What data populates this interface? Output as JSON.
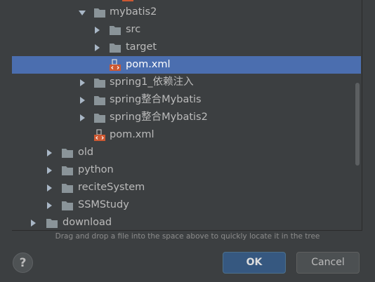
{
  "tree": {
    "items": [
      {
        "label": "mybatis2",
        "type": "folder",
        "expanded": true
      },
      {
        "label": "src",
        "type": "folder",
        "expanded": false
      },
      {
        "label": "target",
        "type": "folder",
        "expanded": false
      },
      {
        "label": "pom.xml",
        "type": "maven-file",
        "selected": true
      },
      {
        "label": "spring1_依赖注入",
        "type": "folder",
        "expanded": false
      },
      {
        "label": "spring整合Mybatis",
        "type": "folder",
        "expanded": false
      },
      {
        "label": "spring整合Mybatis2",
        "type": "folder",
        "expanded": false
      },
      {
        "label": "pom.xml",
        "type": "maven-file"
      },
      {
        "label": "old",
        "type": "folder",
        "expanded": false
      },
      {
        "label": "python",
        "type": "folder",
        "expanded": false
      },
      {
        "label": "reciteSystem",
        "type": "folder",
        "expanded": false
      },
      {
        "label": "SSMStudy",
        "type": "folder",
        "expanded": false
      },
      {
        "label": "download",
        "type": "folder",
        "expanded": false
      }
    ]
  },
  "hint_text": "Drag and drop a file into the space above to quickly locate it in the tree",
  "buttons": {
    "help_label": "?",
    "ok_label": "OK",
    "cancel_label": "Cancel"
  },
  "colors": {
    "background": "#3c3f41",
    "selection": "#4b6eaf",
    "folder_icon": "#8a9499",
    "maven_icon": "#cc5832",
    "ok_button": "#365880"
  }
}
